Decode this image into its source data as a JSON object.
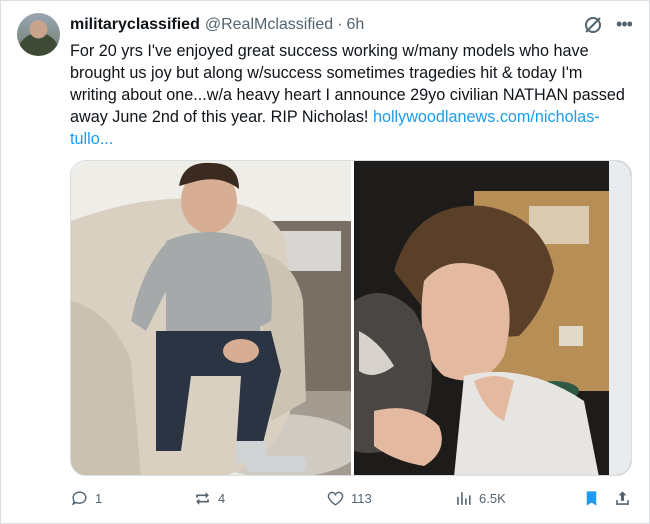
{
  "tweet": {
    "display_name": "militaryclassified",
    "handle": "@RealMclassified",
    "separator": "·",
    "time": "6h",
    "more_label": "•••",
    "body": "For 20 yrs I've enjoyed great success working w/many models who have brought us joy but along w/success sometimes tragedies hit & today I'm writing about one...w/a heavy heart I announce 29yo civilian NATHAN passed away June 2nd of this year. RIP Nicholas! ",
    "link": "hollywoodlanews.com/nicholas-tullo..."
  },
  "media": {
    "images": [
      {
        "description_icon": "photo-young-man-seated-in-armchair"
      },
      {
        "description_icon": "photo-young-man-kissing-cat"
      }
    ]
  },
  "actions": {
    "replies": "1",
    "reposts": "4",
    "likes": "113",
    "views": "6.5K"
  },
  "colors": {
    "accent": "#1d9bf0",
    "text": "#0f1419",
    "secondary": "#536471"
  }
}
